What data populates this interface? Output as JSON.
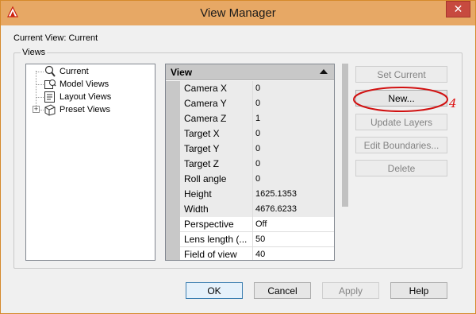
{
  "window": {
    "title": "View Manager"
  },
  "header": {
    "current_view_label": "Current View: Current"
  },
  "views_group_label": "Views",
  "tree": {
    "items": [
      {
        "label": "Current",
        "icon": "magnifier-icon"
      },
      {
        "label": "Model Views",
        "icon": "model-views-icon"
      },
      {
        "label": "Layout Views",
        "icon": "layout-views-icon"
      },
      {
        "label": "Preset Views",
        "icon": "preset-views-icon"
      }
    ]
  },
  "properties": {
    "header": "View",
    "rows": [
      {
        "key": "Camera X",
        "value": "0"
      },
      {
        "key": "Camera Y",
        "value": "0"
      },
      {
        "key": "Camera Z",
        "value": "1"
      },
      {
        "key": "Target X",
        "value": "0"
      },
      {
        "key": "Target Y",
        "value": "0"
      },
      {
        "key": "Target Z",
        "value": "0"
      },
      {
        "key": "Roll angle",
        "value": "0"
      },
      {
        "key": "Height",
        "value": "1625.1353"
      },
      {
        "key": "Width",
        "value": "4676.6233"
      },
      {
        "key": "Perspective",
        "value": "Off"
      },
      {
        "key": "Lens length (...",
        "value": "50"
      },
      {
        "key": "Field of view",
        "value": "40"
      }
    ]
  },
  "side_buttons": {
    "set_current": "Set Current",
    "new": "New...",
    "update_layers": "Update Layers",
    "edit_boundaries": "Edit Boundaries...",
    "delete": "Delete"
  },
  "footer_buttons": {
    "ok": "OK",
    "cancel": "Cancel",
    "apply": "Apply",
    "help": "Help"
  },
  "annotation": {
    "number": "4",
    "color": "#d11111"
  },
  "colors": {
    "titlebar": "#e7a865",
    "close": "#c74a3f"
  }
}
